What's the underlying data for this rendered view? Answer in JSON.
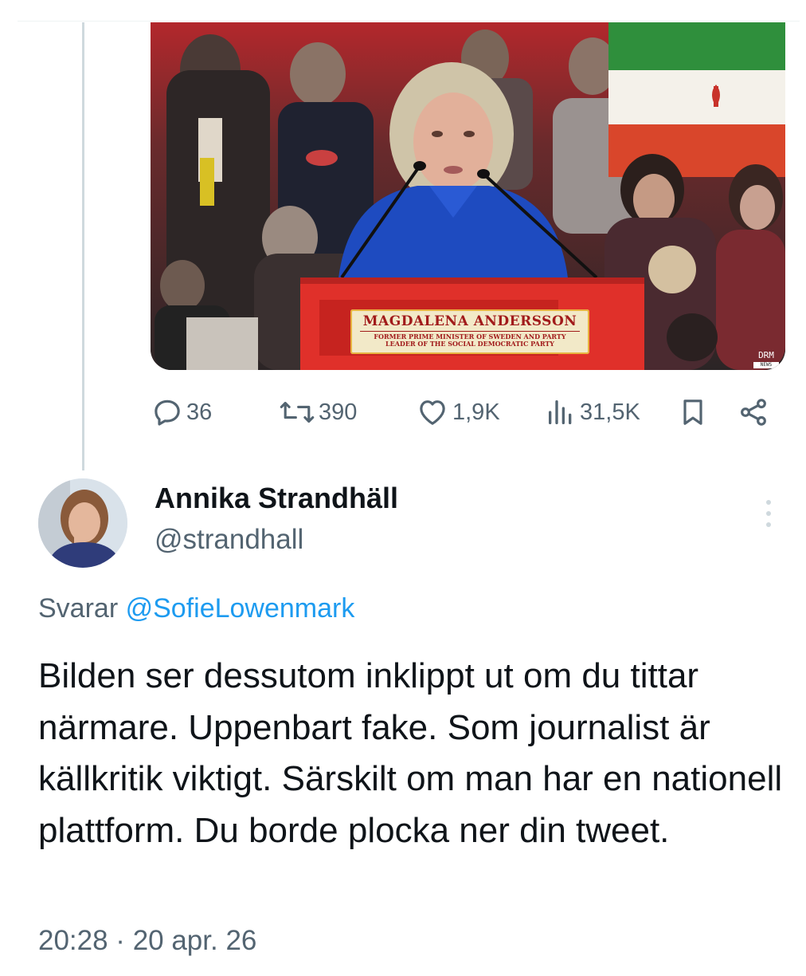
{
  "media": {
    "podium_name": "MAGDALENA ANDERSSON",
    "podium_subtitle_line1": "FORMER PRIME MINISTER OF SWEDEN AND PARTY",
    "podium_subtitle_line2": "LEADER OF THE SOCIAL DEMOCRATIC PARTY",
    "broadcaster_logo": "DRM",
    "broadcaster_sub": "NEWS"
  },
  "actions": {
    "replies": "36",
    "reposts": "390",
    "likes": "1,9K",
    "views": "31,5K"
  },
  "reply_tweet": {
    "display_name": "Annika Strandhäll",
    "handle": "@strandhall",
    "replying_prefix": "Svarar",
    "replying_to": "@SofieLowenmark",
    "text": "Bilden ser dessutom inklippt ut om du tittar närmare. Uppenbart fake. Som journalist är källkritik viktigt. Särskilt om man har en nationell plattform. Du borde plocka ner din tweet.",
    "timestamp": "20:28 · 20 apr. 26"
  },
  "colors": {
    "link": "#1d9bf0",
    "secondary_text": "#536471",
    "primary_text": "#0f1419",
    "thread_line": "#cfd9de",
    "podium_red": "#e0302a"
  },
  "icons": [
    "reply-icon",
    "repost-icon",
    "like-icon",
    "views-icon",
    "bookmark-icon",
    "share-icon",
    "more-icon"
  ]
}
